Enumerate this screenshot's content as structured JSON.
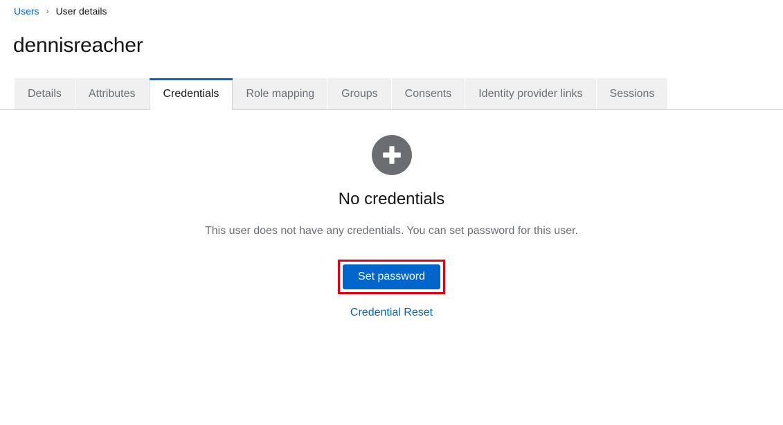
{
  "breadcrumb": {
    "parent": "Users",
    "separator": "›",
    "current": "User details"
  },
  "page_title": "dennisreacher",
  "tabs": [
    {
      "label": "Details",
      "active": false
    },
    {
      "label": "Attributes",
      "active": false
    },
    {
      "label": "Credentials",
      "active": true
    },
    {
      "label": "Role mapping",
      "active": false
    },
    {
      "label": "Groups",
      "active": false
    },
    {
      "label": "Consents",
      "active": false
    },
    {
      "label": "Identity provider links",
      "active": false
    },
    {
      "label": "Sessions",
      "active": false
    }
  ],
  "empty_state": {
    "icon": "plus-circle-icon",
    "title": "No credentials",
    "body": "This user does not have any credentials. You can set password for this user.",
    "primary_button": "Set password",
    "secondary_link": "Credential Reset"
  },
  "colors": {
    "accent_blue": "#0066cc",
    "link_blue": "#06c",
    "icon_gray": "#6a6e73",
    "tab_bg": "#f0f0f0",
    "annotation_red": "#e3000f",
    "text_dark": "#151515",
    "text_muted": "#6a6e73",
    "border_gray": "#d2d2d2"
  }
}
